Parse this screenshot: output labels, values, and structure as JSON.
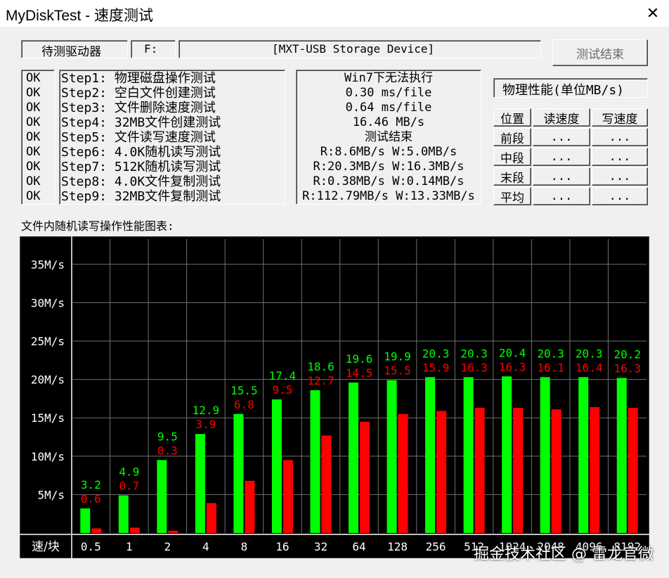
{
  "window": {
    "title": "MyDiskTest - 速度测试",
    "close_glyph": "✕"
  },
  "drive": {
    "label": "待测驱动器",
    "letter": "F:",
    "device": "[MXT-USB Storage Device]"
  },
  "buttons": {
    "end_test": "测试结束"
  },
  "steps": {
    "status": [
      "OK",
      "OK",
      "OK",
      "OK",
      "OK",
      "OK",
      "OK",
      "OK",
      "OK"
    ],
    "names": [
      "Step1: 物理磁盘操作测试",
      "Step2: 空白文件创建测试",
      "Step3: 文件删除速度测试",
      "Step4: 32MB文件创建测试",
      "Step5: 文件读写速度测试",
      "Step6: 4.0K随机读写测试",
      "Step7: 512K随机读写测试",
      "Step8: 4.0K文件复制测试",
      "Step9: 32MB文件复制测试"
    ],
    "results": [
      "Win7下无法执行",
      "0.30 ms/file",
      "0.64 ms/file",
      "16.46 MB/s",
      "测试结束",
      "R:8.6MB/s W:5.0MB/s",
      "R:20.3MB/s W:16.3MB/s",
      "R:0.38MB/s W:0.14MB/s",
      "R:112.79MB/s W:13.33MB/s"
    ]
  },
  "physical": {
    "header": "物理性能(单位MB/s)",
    "columns": [
      "位置",
      "读速度",
      "写速度"
    ],
    "rows": [
      {
        "pos": "前段",
        "read": "...",
        "write": "..."
      },
      {
        "pos": "中段",
        "read": "...",
        "write": "..."
      },
      {
        "pos": "末段",
        "read": "...",
        "write": "..."
      },
      {
        "pos": "平均",
        "read": "...",
        "write": "..."
      }
    ]
  },
  "chart_caption": "文件内随机读写操作性能图表:",
  "chart_data": {
    "type": "bar",
    "title": "文件内随机读写操作性能图表:",
    "xlabel": "速/块",
    "ylabel": "",
    "categories": [
      "0.5",
      "1",
      "2",
      "4",
      "8",
      "16",
      "32",
      "64",
      "128",
      "256",
      "512",
      "1024",
      "2048",
      "4096",
      "8192"
    ],
    "y_tick_labels": [
      "5M/s",
      "10M/s",
      "15M/s",
      "20M/s",
      "25M/s",
      "30M/s",
      "35M/s"
    ],
    "y_ticks": [
      5,
      10,
      15,
      20,
      25,
      30,
      35
    ],
    "ylim": [
      0,
      37
    ],
    "grid": true,
    "series": [
      {
        "color": "#00ff00",
        "values": [
          3.2,
          4.9,
          9.5,
          12.9,
          15.5,
          17.4,
          18.6,
          19.6,
          19.9,
          20.3,
          20.3,
          20.4,
          20.3,
          20.3,
          20.2
        ],
        "labels": [
          "3.2",
          "4.9",
          "9.5",
          "12.9",
          "15.5",
          "17.4",
          "18.6",
          "19.6",
          "19.9",
          "20.3",
          "20.3",
          "20.4",
          "20.3",
          "20.3",
          "20.2"
        ]
      },
      {
        "color": "#ff0000",
        "values": [
          0.6,
          0.7,
          0.3,
          3.9,
          6.8,
          9.5,
          12.7,
          14.5,
          15.5,
          15.9,
          16.3,
          16.3,
          16.1,
          16.4,
          16.3
        ],
        "labels": [
          "0.6",
          "0.7",
          "0.3",
          "3.9",
          "6.8",
          "9.5",
          "12.7",
          "14.5",
          "15.5",
          "15.9",
          "16.3",
          "16.3",
          "16.1",
          "16.4",
          "16.3"
        ]
      }
    ],
    "background": "#000000",
    "grid_color": "#707070"
  },
  "watermark": "掘金技术社区 @ 雷龙官微"
}
